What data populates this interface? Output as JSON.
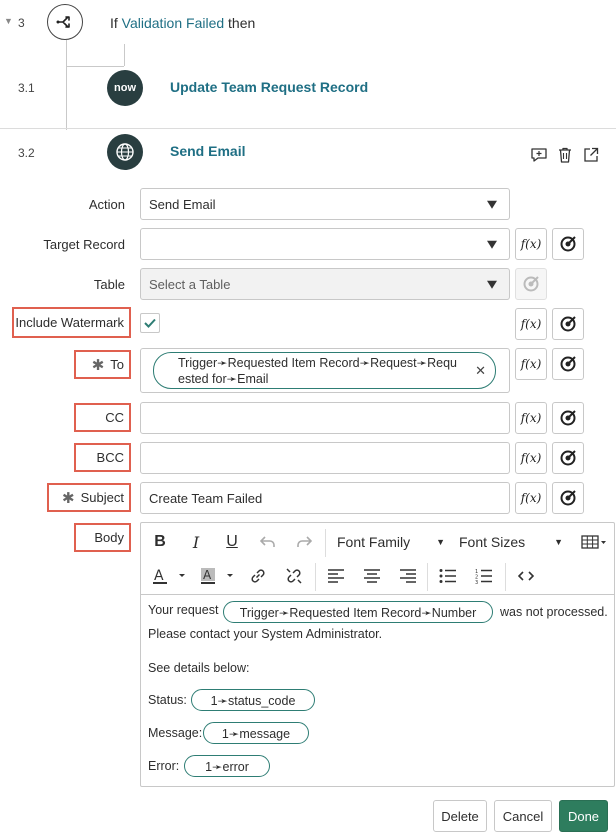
{
  "steps": {
    "s3": {
      "num": "3",
      "prefix": "If",
      "condition": "Validation Failed",
      "suffix": "then"
    },
    "s31": {
      "num": "3.1",
      "title": "Update Team Request Record",
      "logo": "now"
    },
    "s32": {
      "num": "3.2",
      "title": "Send Email"
    }
  },
  "form": {
    "action": {
      "label": "Action",
      "value": "Send Email"
    },
    "target_record": {
      "label": "Target Record",
      "value": ""
    },
    "table": {
      "label": "Table",
      "placeholder": "Select a Table"
    },
    "include_watermark": {
      "label": "Include Watermark",
      "checked": true
    },
    "to": {
      "label": "To",
      "pill_line1": "Trigger➛Requested Item Record➛Request➛Requ",
      "pill_line2": "ested for➛Email"
    },
    "cc": {
      "label": "CC",
      "value": ""
    },
    "bcc": {
      "label": "BCC",
      "value": ""
    },
    "subject": {
      "label": "Subject",
      "value": "Create Team Failed"
    },
    "body": {
      "label": "Body"
    },
    "required_mark": "✱",
    "fx_label": "f(x)"
  },
  "toolbar": {
    "font_family": "Font Family",
    "font_sizes": "Font Sizes",
    "bold": "B",
    "italic": "I",
    "underline": "U"
  },
  "body_content": {
    "line1_pre": "Your request",
    "pill_number": "Trigger➛Requested Item Record➛Number",
    "line1_post": "was not processed.",
    "line2": "Please contact your System Administrator.",
    "line3": "See details below:",
    "status_label": "Status:",
    "status_pill": "1➛status_code",
    "message_label": "Message:",
    "message_pill": "1➛message",
    "error_label": "Error:",
    "error_pill": "1➛error"
  },
  "buttons": {
    "delete": "Delete",
    "cancel": "Cancel",
    "done": "Done"
  },
  "colors": {
    "accent": "#1f6f84",
    "highlight_border": "#e0604f",
    "done": "#2e7d5e",
    "pill_border": "#2e7d74"
  }
}
